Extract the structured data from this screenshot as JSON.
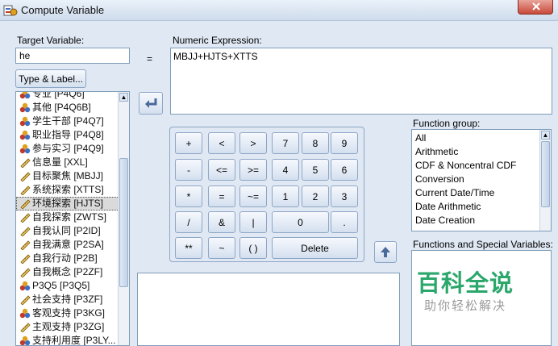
{
  "window": {
    "title": "Compute Variable",
    "accent": "#cfdcec"
  },
  "target": {
    "label": "Target Variable:",
    "value": "he",
    "equals": "=",
    "type_label_button": "Type & Label..."
  },
  "expression": {
    "label": "Numeric Expression:",
    "value": "MBJJ+HJTS+XTTS"
  },
  "variables": [
    {
      "label": "专业 [P4Q6]",
      "icon": "nominal-icon"
    },
    {
      "label": "其他 [P4Q6B]",
      "icon": "nominal-icon"
    },
    {
      "label": "学生干部 [P4Q7]",
      "icon": "nominal-icon"
    },
    {
      "label": "职业指导 [P4Q8]",
      "icon": "nominal-icon"
    },
    {
      "label": "参与实习 [P4Q9]",
      "icon": "nominal-icon"
    },
    {
      "label": "信息量 [XXL]",
      "icon": "scale-icon"
    },
    {
      "label": "目标聚焦 [MBJJ]",
      "icon": "scale-icon"
    },
    {
      "label": "系统探索 [XTTS]",
      "icon": "scale-icon"
    },
    {
      "label": "环境探索 [HJTS]",
      "icon": "scale-icon",
      "selected": true
    },
    {
      "label": "自我探索 [ZWTS]",
      "icon": "scale-icon"
    },
    {
      "label": "自我认同 [P2ID]",
      "icon": "scale-icon"
    },
    {
      "label": "自我满意 [P2SA]",
      "icon": "scale-icon"
    },
    {
      "label": "自我行动 [P2B]",
      "icon": "scale-icon"
    },
    {
      "label": "自我概念 [P2ZF]",
      "icon": "scale-icon"
    },
    {
      "label": "P3Q5 [P3Q5]",
      "icon": "nominal-icon"
    },
    {
      "label": "社会支持 [P3ZF]",
      "icon": "scale-icon"
    },
    {
      "label": "客观支持 [P3KG]",
      "icon": "nominal-icon"
    },
    {
      "label": "主观支持 [P3ZG]",
      "icon": "scale-icon"
    },
    {
      "label": "支持利用度 [P3LY...",
      "icon": "nominal-icon"
    }
  ],
  "keypad": {
    "plus": "+",
    "lt": "<",
    "gt": ">",
    "seven": "7",
    "eight": "8",
    "nine": "9",
    "minus": "-",
    "le": "<=",
    "ge": ">=",
    "four": "4",
    "five": "5",
    "six": "6",
    "mult": "*",
    "eq": "=",
    "ne": "~=",
    "one": "1",
    "two": "2",
    "three": "3",
    "div": "/",
    "and": "&",
    "or": "|",
    "zero": "0",
    "dot": ".",
    "pow": "**",
    "not": "~",
    "paren": "( )",
    "delete": "Delete"
  },
  "function_group": {
    "label": "Function group:",
    "items": [
      "All",
      "Arithmetic",
      "CDF & Noncentral CDF",
      "Conversion",
      "Current Date/Time",
      "Date Arithmetic",
      "Date Creation"
    ]
  },
  "functions": {
    "label": "Functions and Special Variables:"
  },
  "watermark": {
    "main": "百科全说",
    "sub": "助你轻松解决"
  }
}
